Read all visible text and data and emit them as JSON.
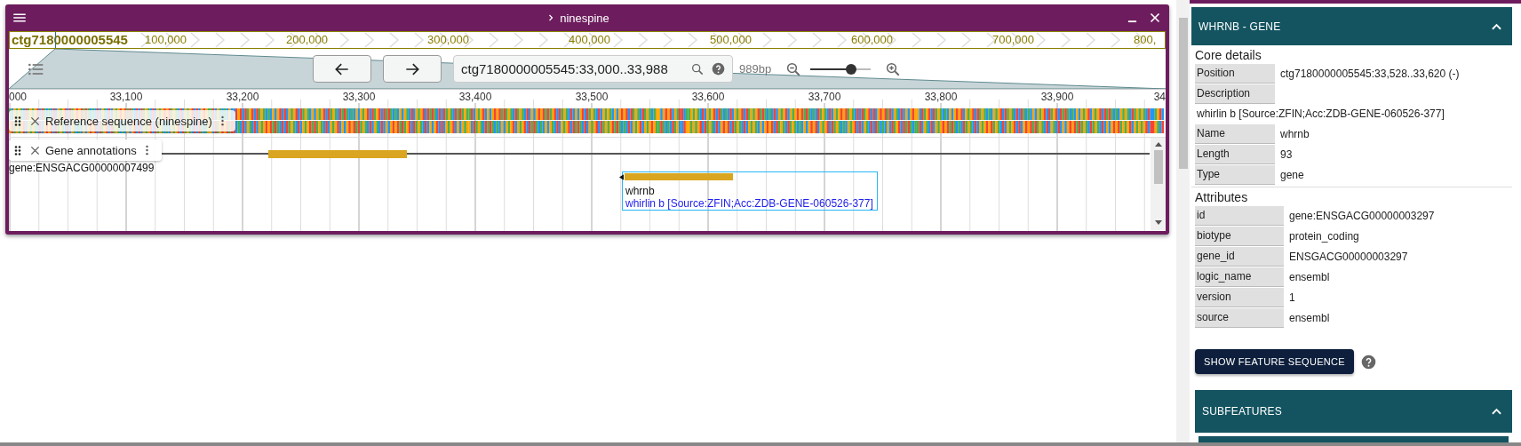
{
  "window": {
    "title": "ninespine"
  },
  "overview": {
    "sequence": "ctg7180000005545",
    "ticks": [
      "100,000",
      "200,000",
      "300,000",
      "400,000",
      "500,000",
      "600,000",
      "700,000",
      "800,"
    ]
  },
  "navigation": {
    "location": "ctg7180000005545:33,000..33,988",
    "span": "989bp",
    "zoom": {
      "level": 0.68
    }
  },
  "ruler": {
    "ticks": [
      "000",
      "33,100",
      "33,200",
      "33,300",
      "33,400",
      "33,500",
      "33,600",
      "33,700",
      "33,800",
      "33,900",
      "34"
    ]
  },
  "tracks": [
    {
      "kind": "sequence",
      "name": "Reference sequence (ninespine)"
    },
    {
      "kind": "genes",
      "name": "Gene annotations",
      "features": [
        {
          "label": "gene:ENSGACG00000007499",
          "selected": false
        },
        {
          "label": "whrnb",
          "description": "whirlin b [Source:ZFIN;Acc:ZDB-GENE-060526-377]",
          "selected": true
        }
      ]
    }
  ],
  "detail_panel": {
    "title": "WHRNB - GENE",
    "expanded": true,
    "sections": [
      {
        "title": "Core details",
        "kind": "core",
        "rows": [
          {
            "label": "Position",
            "value": "ctg7180000005545:33,528..33,620 (-)"
          },
          {
            "label": "Description",
            "value": "whirlin b [Source:ZFIN;Acc:ZDB-GENE-060526-377]",
            "kind": "block"
          },
          {
            "label": "Name",
            "value": "whrnb"
          },
          {
            "label": "Length",
            "value": "93"
          },
          {
            "label": "Type",
            "value": "gene"
          }
        ]
      },
      {
        "title": "Attributes",
        "kind": "attributes",
        "rows": [
          {
            "label": "id",
            "value": "gene:ENSGACG00000003297"
          },
          {
            "label": "biotype",
            "value": "protein_coding"
          },
          {
            "label": "gene_id",
            "value": "ENSGACG00000003297"
          },
          {
            "label": "logic_name",
            "value": "ensembl"
          },
          {
            "label": "version",
            "value": "1"
          },
          {
            "label": "source",
            "value": "ensembl"
          }
        ]
      }
    ],
    "button": "SHOW FEATURE SEQUENCE",
    "subfeatures": {
      "title": "SUBFEATURES",
      "expanded": true
    }
  }
}
